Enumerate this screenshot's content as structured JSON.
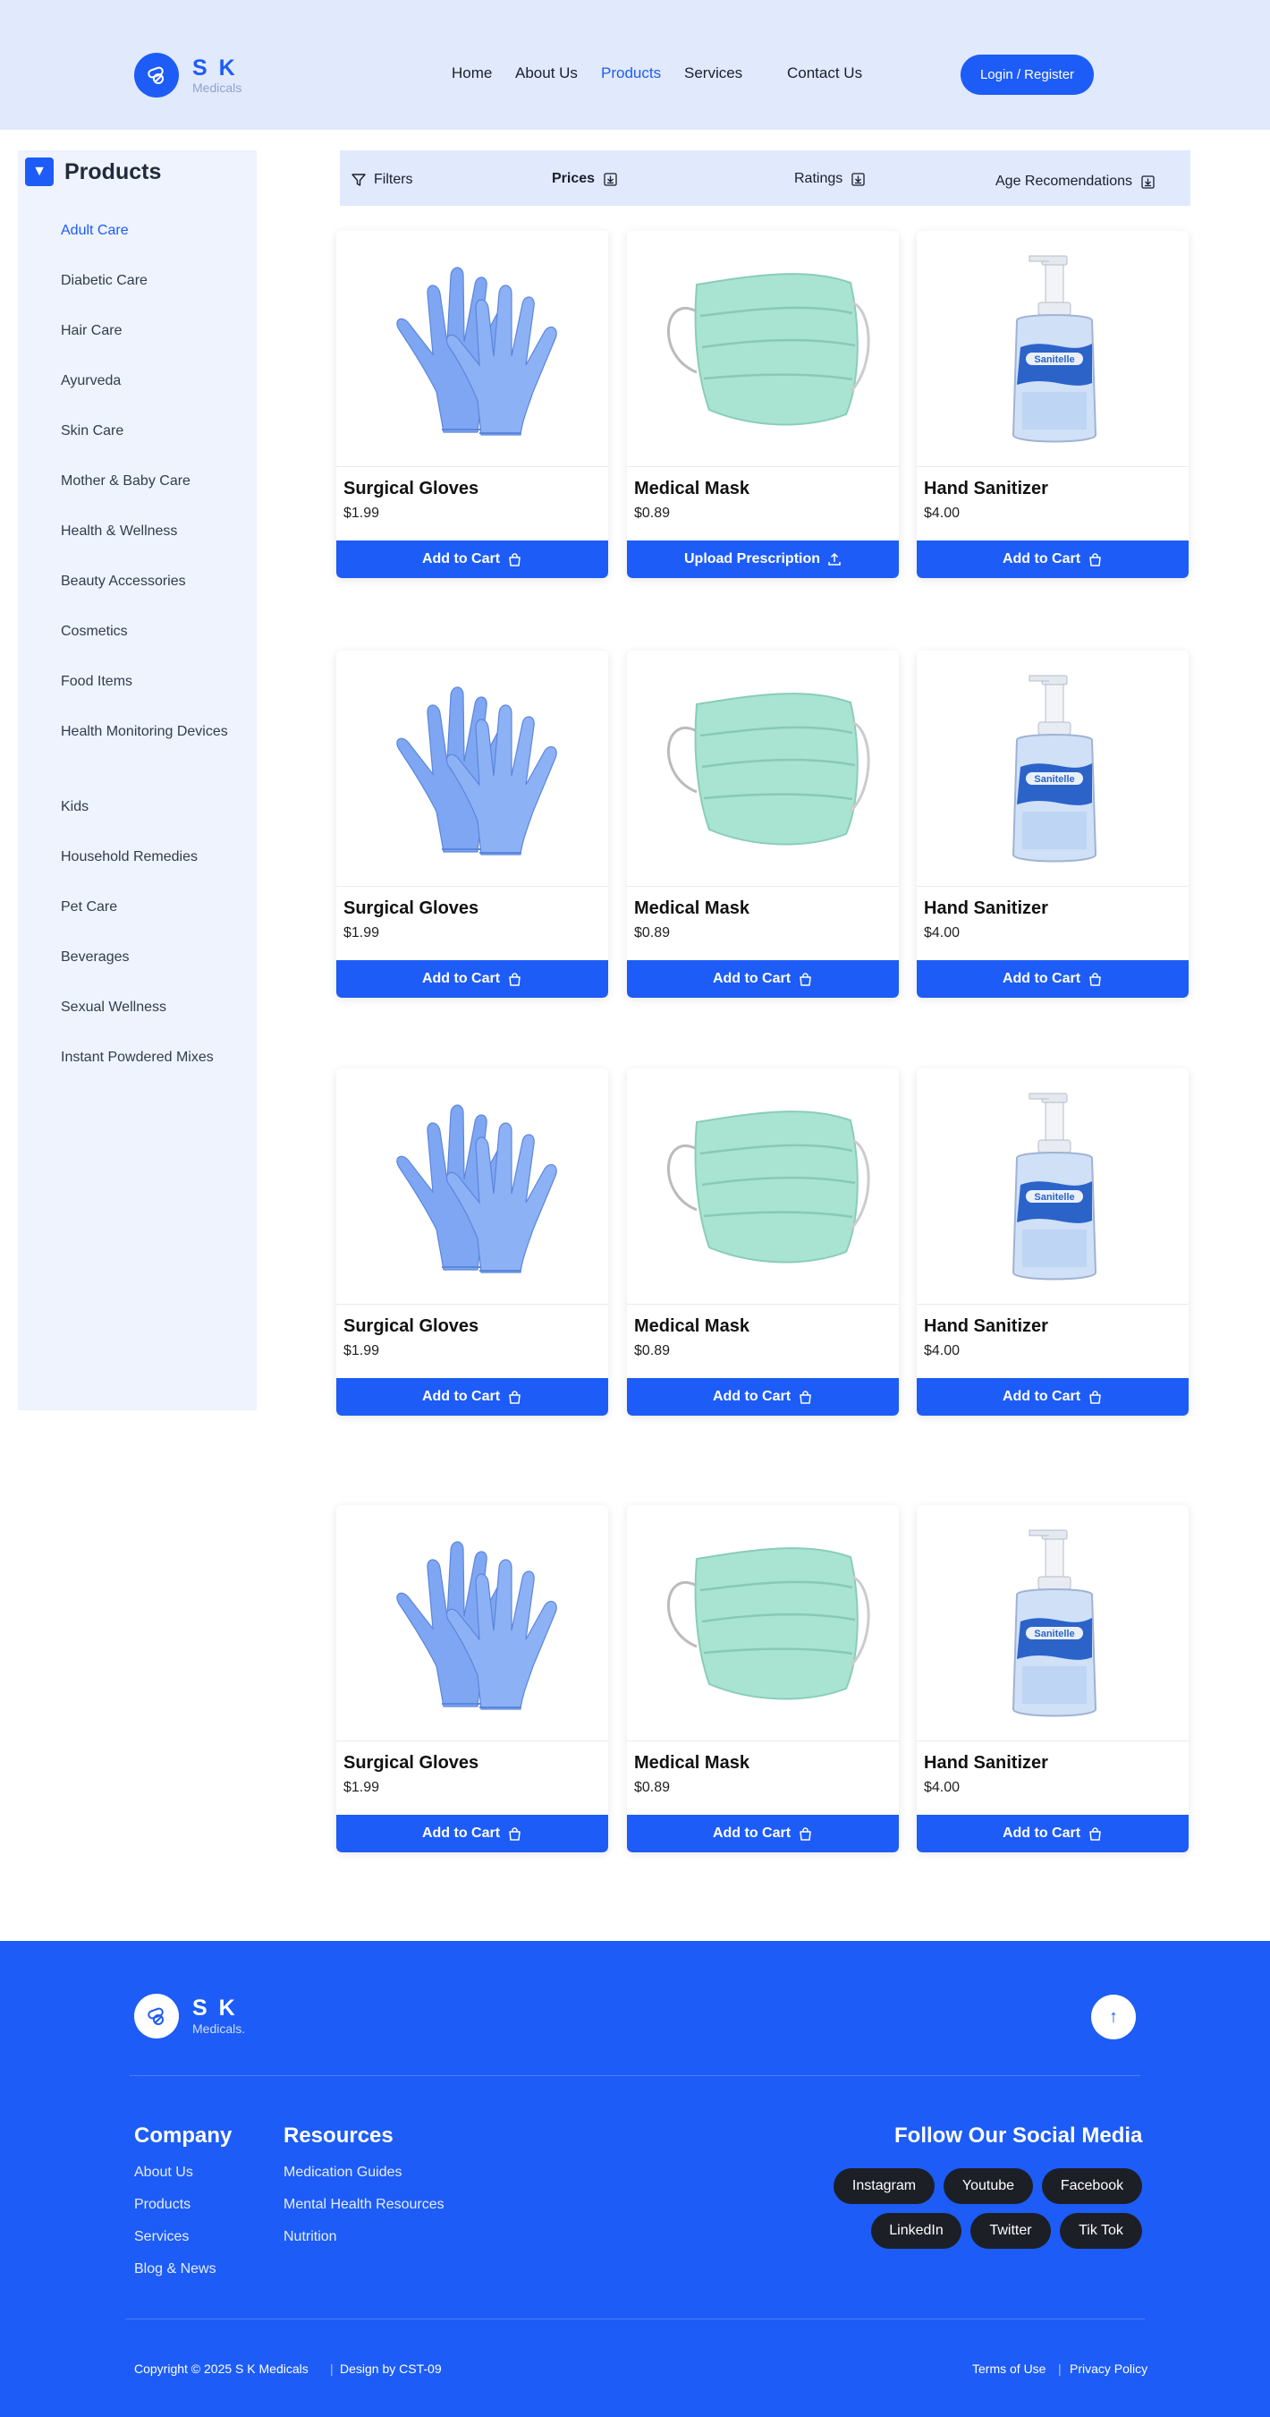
{
  "header": {
    "brand_name": "S K",
    "brand_sub": "Medicals",
    "nav": [
      "Home",
      "About Us",
      "Products",
      "Services",
      "Contact Us"
    ],
    "active_nav": "Products",
    "login_label": "Login / Register"
  },
  "sidebar": {
    "title": "Products",
    "toggle_glyph": "▼",
    "items": [
      "Adult Care",
      "Diabetic Care",
      "Hair Care",
      "Ayurveda",
      "Skin Care",
      "Mother & Baby Care",
      "Health & Wellness",
      "Beauty Accessories",
      "Cosmetics",
      "Food Items",
      "Health Monitoring Devices",
      "Kids",
      "Household Remedies",
      "Pet Care",
      "Beverages",
      "Sexual Wellness",
      "Instant Powdered Mixes"
    ],
    "active_item": "Adult Care"
  },
  "filters": {
    "filters_label": "Filters",
    "prices_label": "Prices",
    "ratings_label": "Ratings",
    "age_label": "Age Recomendations"
  },
  "products": [
    {
      "name": "Surgical Gloves",
      "price": "$1.99",
      "button": "Add to Cart",
      "image": "gloves"
    },
    {
      "name": "Medical Mask",
      "price": "$0.89",
      "button": "Upload Prescription",
      "image": "mask"
    },
    {
      "name": "Hand Sanitizer",
      "price": "$4.00",
      "button": "Add to Cart",
      "image": "sanitizer"
    },
    {
      "name": "Surgical Gloves",
      "price": "$1.99",
      "button": "Add to Cart",
      "image": "gloves"
    },
    {
      "name": "Medical Mask",
      "price": "$0.89",
      "button": "Add to Cart",
      "image": "mask"
    },
    {
      "name": "Hand Sanitizer",
      "price": "$4.00",
      "button": "Add to Cart",
      "image": "sanitizer"
    },
    {
      "name": "Surgical Gloves",
      "price": "$1.99",
      "button": "Add to Cart",
      "image": "gloves"
    },
    {
      "name": "Medical Mask",
      "price": "$0.89",
      "button": "Add to Cart",
      "image": "mask"
    },
    {
      "name": "Hand Sanitizer",
      "price": "$4.00",
      "button": "Add to Cart",
      "image": "sanitizer"
    },
    {
      "name": "Surgical Gloves",
      "price": "$1.99",
      "button": "Add to Cart",
      "image": "gloves"
    },
    {
      "name": "Medical Mask",
      "price": "$0.89",
      "button": "Add to Cart",
      "image": "mask"
    },
    {
      "name": "Hand Sanitizer",
      "price": "$4.00",
      "button": "Add to Cart",
      "image": "sanitizer"
    }
  ],
  "sanitizer_label": "Sanitelle",
  "footer": {
    "brand_name": "S K",
    "brand_sub": "Medicals.",
    "up_glyph": "↑",
    "company_title": "Company",
    "company_links": [
      "About Us",
      "Products",
      "Services",
      "Blog & News"
    ],
    "resources_title": "Resources",
    "resources_links": [
      "Medication Guides",
      "Mental Health Resources",
      "Nutrition"
    ],
    "social_title": "Follow Our Social Media",
    "social_row1": [
      "Instagram",
      "Youtube",
      "Facebook"
    ],
    "social_row2": [
      "LinkedIn",
      "Twitter",
      "Tik Tok"
    ],
    "copyright": "Copyright © 2025 S K Medicals",
    "design": "Design by CST-09",
    "terms": "Terms of Use",
    "privacy": "Privacy Policy"
  },
  "colors": {
    "primary": "#1d5cf6",
    "header_bg": "#e1e9fd",
    "sidebar_bg": "#eef3fe",
    "pill": "#1c1f26"
  }
}
